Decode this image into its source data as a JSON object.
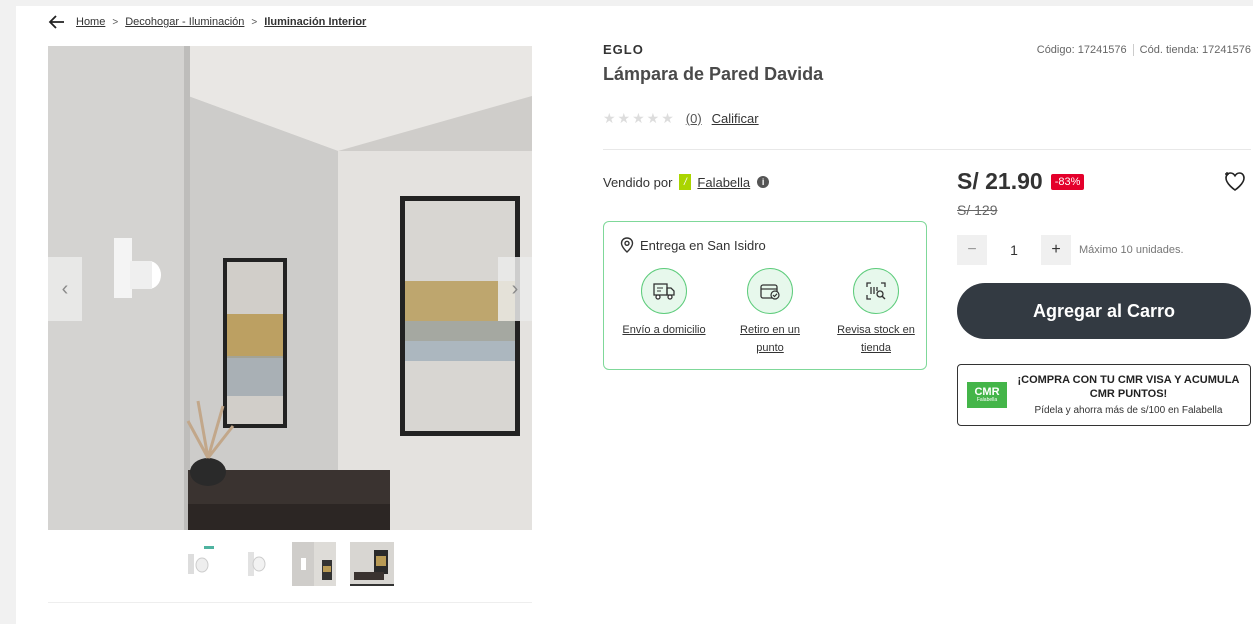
{
  "breadcrumb": {
    "items": [
      "Home",
      "Decohogar - Iluminación",
      "Iluminación Interior"
    ],
    "separator": ">"
  },
  "product": {
    "brand": "EGLO",
    "title": "Lámpara de Pared Davida",
    "code_label": "Código: 17241576",
    "store_code_label": "Cód. tienda: 17241576",
    "rating_count": "(0)",
    "rate_label": "Calificar",
    "stars": "★★★★★"
  },
  "seller": {
    "prefix": "Vendido por",
    "name": "Falabella"
  },
  "delivery": {
    "location": "Entrega en San Isidro",
    "options": [
      {
        "label": "Envío a domicilio",
        "icon": "truck-icon"
      },
      {
        "label": "Retiro en un punto",
        "icon": "store-pickup-icon"
      },
      {
        "label": "Revisa stock en tienda",
        "icon": "stock-search-icon"
      }
    ]
  },
  "price": {
    "current": "S/ 21.90",
    "discount": "-83%",
    "original": "S/ 129"
  },
  "quantity": {
    "value": "1",
    "minus": "−",
    "plus": "+",
    "max_label": "Máximo 10 unidades."
  },
  "cart": {
    "button_label": "Agregar al Carro"
  },
  "cmr": {
    "logo": "CMR",
    "logo_sub": "Falabella",
    "title": "¡COMPRA CON TU CMR VISA Y ACUMULA CMR PUNTOS!",
    "subtitle": "Pídela y ahorra más de s/100 en Falabella"
  },
  "gallery": {
    "prev": "‹",
    "next": "›",
    "thumbnail_count": 4
  },
  "colors": {
    "accent_dark": "#333a42",
    "discount_red": "#e4002b",
    "delivery_green": "#7fd899",
    "falabella_green": "#aad500",
    "cmr_green": "#44b549"
  }
}
